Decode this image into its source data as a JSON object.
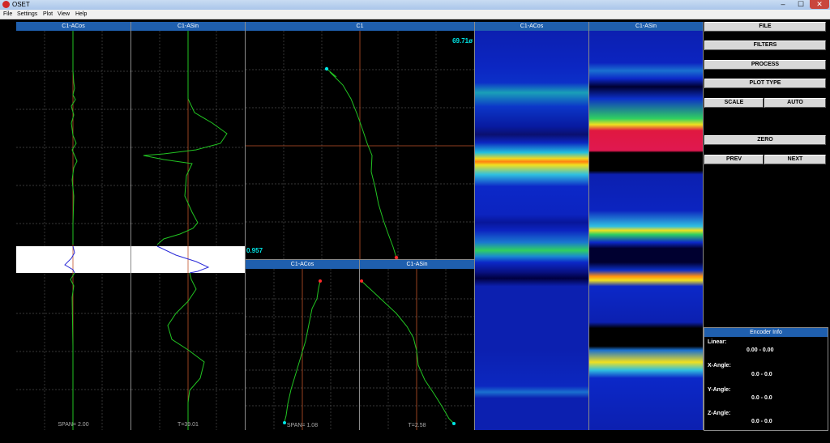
{
  "window": {
    "title": "OSET",
    "minimize": "–",
    "maximize": "☐",
    "close": "✕"
  },
  "menu": [
    {
      "label": "File"
    },
    {
      "label": "Settings"
    },
    {
      "label": "Plot"
    },
    {
      "label": "View"
    },
    {
      "label": "Help"
    }
  ],
  "panels": {
    "strip_acos": {
      "title": "C1-ACos",
      "footer": "SPAN= 2.00"
    },
    "strip_asin": {
      "title": "C1-ASin",
      "footer": "T=39.01"
    },
    "lissajous": {
      "title": "C1",
      "angle": "69.71ø",
      "value": "0.957"
    },
    "zoom_acos": {
      "title": "C1-ACos",
      "footer": "SPAN= 1.08"
    },
    "zoom_asin": {
      "title": "C1-ASin",
      "footer": "T=2.58"
    },
    "map_acos": {
      "title": "C1-ACos"
    },
    "map_asin": {
      "title": "C1-ASin"
    }
  },
  "buttons": {
    "file": "FILE",
    "filters": "FILTERS",
    "process": "PROCESS",
    "plot_type": "PLOT TYPE",
    "scale": "SCALE",
    "auto": "AUTO",
    "zero": "ZERO",
    "prev": "PREV",
    "next": "NEXT"
  },
  "encoder": {
    "title": "Encoder Info",
    "linear_label": "Linear:",
    "linear_value": "0.00 - 0.00",
    "xangle_label": "X-Angle:",
    "xangle_value": "0.0 - 0.0",
    "yangle_label": "Y-Angle:",
    "yangle_value": "0.0 - 0.0",
    "zangle_label": "Z-Angle:",
    "zangle_value": "0.0 - 0.0"
  },
  "colors": {
    "accent": "#1f5fae",
    "trace": "#22c422",
    "marker_start": "#00e5e5",
    "marker_end": "#ff2a2a",
    "cursor": "#c0532a"
  }
}
